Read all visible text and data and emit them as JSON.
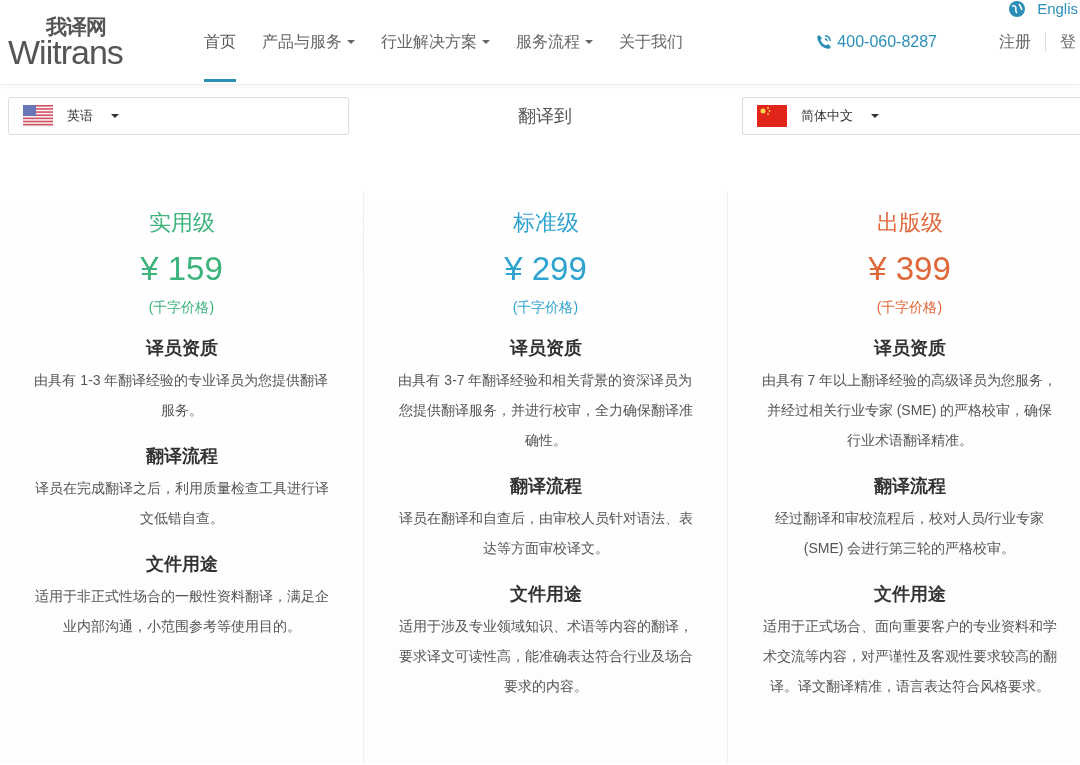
{
  "header": {
    "logo": {
      "cn": "我译网",
      "en": "Wiitrans"
    },
    "nav": [
      {
        "label": "首页",
        "selected": true,
        "has_menu": false
      },
      {
        "label": "产品与服务",
        "selected": false,
        "has_menu": true
      },
      {
        "label": "行业解决方案",
        "selected": false,
        "has_menu": true
      },
      {
        "label": "服务流程",
        "selected": false,
        "has_menu": true
      },
      {
        "label": "关于我们",
        "selected": false,
        "has_menu": false
      }
    ],
    "phone": "400-060-8287",
    "register": "注册",
    "login": "登",
    "language": "Englis"
  },
  "translator": {
    "source": {
      "kind": "us",
      "label": "英语"
    },
    "direction": "翻译到",
    "target": {
      "kind": "cn",
      "label": "简体中文"
    }
  },
  "tiers": [
    {
      "name": "实用级",
      "price": "¥ 159",
      "unit": "(千字价格)",
      "color": "#3cb37a",
      "sections": [
        {
          "title": "译员资质",
          "text": "由具有 1-3 年翻译经验的专业译员为您提供翻译服务。"
        },
        {
          "title": "翻译流程",
          "text": "译员在完成翻译之后，利用质量检查工具进行译文低错自查。"
        },
        {
          "title": "文件用途",
          "text": "适用于非正式性场合的一般性资料翻译，满足企业内部沟通，小范围参考等使用目的。"
        }
      ]
    },
    {
      "name": "标准级",
      "price": "¥ 299",
      "unit": "(千字价格)",
      "color": "#2fa3cf",
      "sections": [
        {
          "title": "译员资质",
          "text": "由具有 3-7 年翻译经验和相关背景的资深译员为您提供翻译服务，并进行校审，全力确保翻译准确性。"
        },
        {
          "title": "翻译流程",
          "text": "译员在翻译和自查后，由审校人员针对语法、表达等方面审校译文。"
        },
        {
          "title": "文件用途",
          "text": "适用于涉及专业领域知识、术语等内容的翻译，要求译文可读性高，能准确表达符合行业及场合要求的内容。"
        }
      ]
    },
    {
      "name": "出版级",
      "price": "¥ 399",
      "unit": "(千字价格)",
      "color": "#e0673a",
      "sections": [
        {
          "title": "译员资质",
          "text": "由具有 7 年以上翻译经验的高级译员为您服务，并经过相关行业专家 (SME) 的严格校审，确保行业术语翻译精准。"
        },
        {
          "title": "翻译流程",
          "text": "经过翻译和审校流程后，校对人员/行业专家 (SME) 会进行第三轮的严格校审。"
        },
        {
          "title": "文件用途",
          "text": "适用于正式场合、面向重要客户的专业资料和学术交流等内容，对严谨性及客观性要求较高的翻译。译文翻译精准，语言表达符合风格要求。"
        }
      ]
    }
  ]
}
